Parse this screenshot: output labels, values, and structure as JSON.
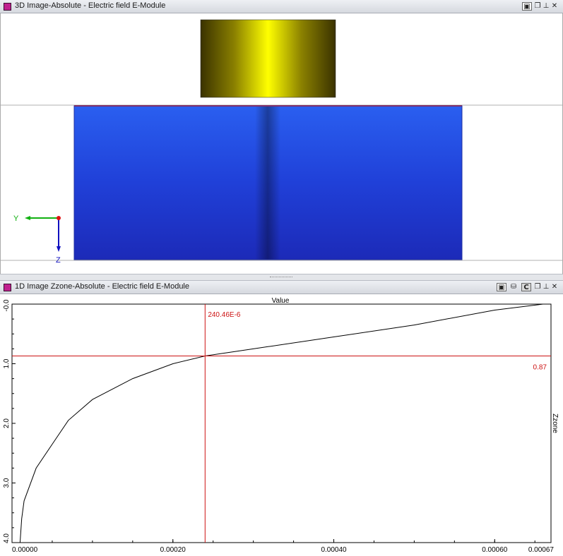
{
  "top_panel": {
    "title": "3D Image-Absolute - Electric field E-Module",
    "axis_y_label": "Y",
    "axis_z_label": "Z",
    "buttons": {
      "camera": "▣",
      "restore": "❐",
      "pin": "⊥",
      "close": "✕"
    }
  },
  "bottom_panel": {
    "title": "1D Image Zzone-Absolute - Electric field E-Module",
    "buttons": {
      "camera": "▣",
      "db": "⛁",
      "c": "C",
      "restore": "❐",
      "pin": "⊥",
      "close": "✕"
    }
  },
  "chart_data": {
    "type": "line",
    "xlabel": "Value",
    "ylabel": "Zzone",
    "xlim": [
      0,
      0.00067
    ],
    "ylim": [
      0,
      4.0
    ],
    "y_inverted": true,
    "x_ticks": [
      "0.00000",
      "0.00020",
      "0.00040",
      "0.00060",
      "0.00067"
    ],
    "x_tick_values": [
      0,
      0.0002,
      0.0004,
      0.0006,
      0.00067
    ],
    "y_ticks": [
      "-0.0",
      "1.0",
      "2.0",
      "3.0",
      "4.0"
    ],
    "y_tick_values": [
      0,
      1,
      2,
      3,
      4
    ],
    "series": [
      {
        "x": [
          0.00066,
          0.0006,
          0.0005,
          0.0004,
          0.0003,
          0.00024,
          0.0002,
          0.00015,
          0.0001,
          7e-05,
          5e-05,
          3e-05,
          1.5e-05,
          1.2e-05,
          1e-05
        ],
        "y": [
          0.0,
          0.1,
          0.35,
          0.55,
          0.75,
          0.87,
          1.0,
          1.25,
          1.6,
          1.95,
          2.35,
          2.75,
          3.3,
          3.6,
          4.0
        ],
        "color": "#000000"
      }
    ],
    "crosshair": {
      "x": 0.00024,
      "y": 0.87,
      "x_label": "240.46E-6",
      "y_label": "0.87",
      "color": "#cc1111"
    },
    "grid": false
  }
}
